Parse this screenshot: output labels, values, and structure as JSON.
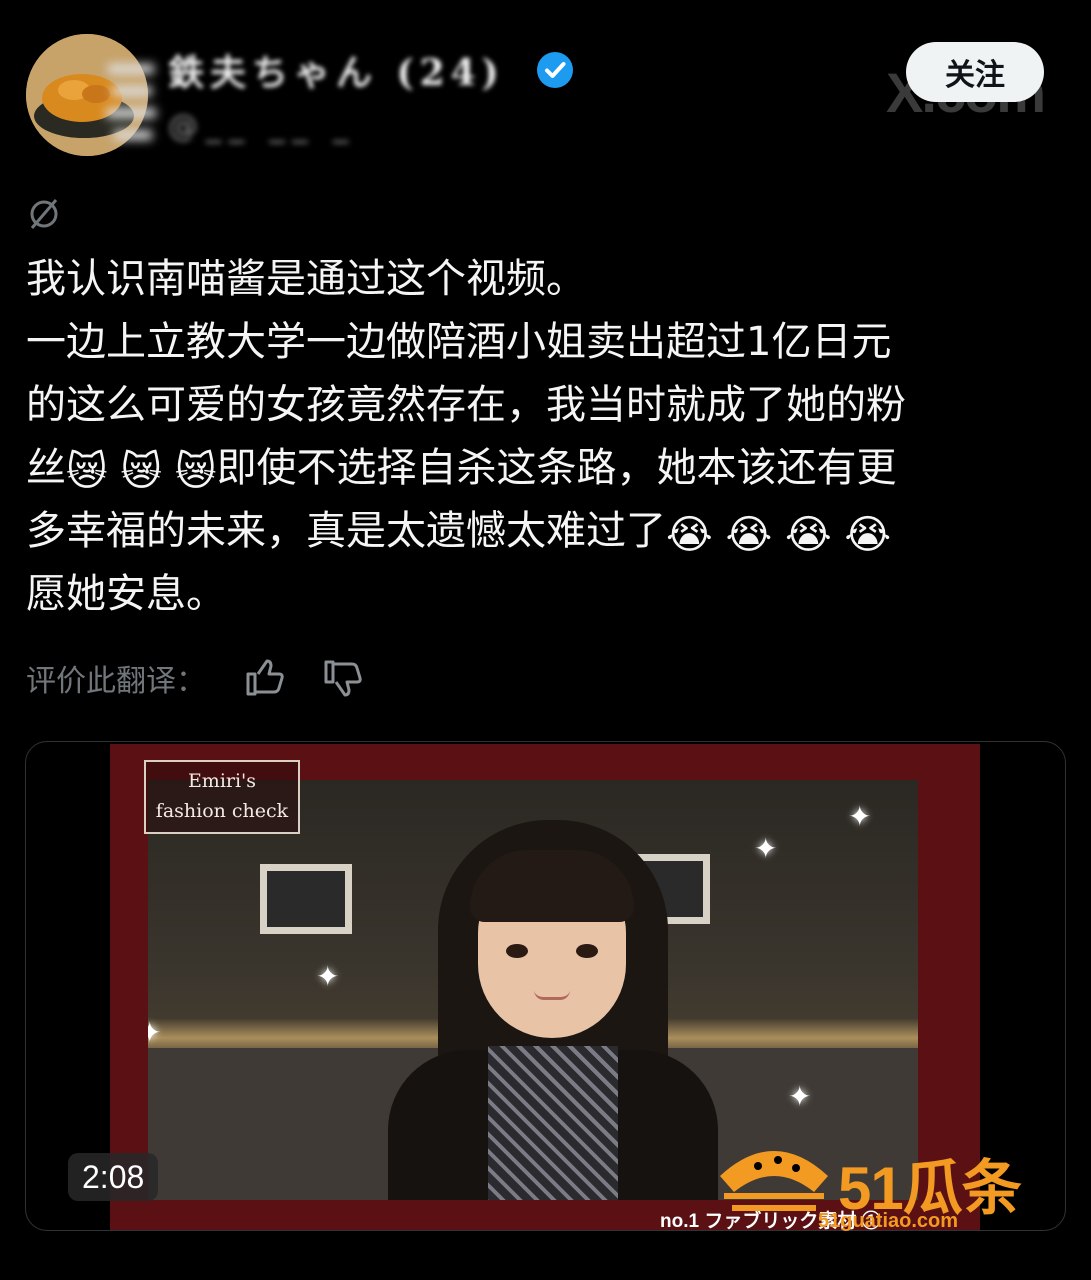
{
  "header": {
    "display_name": "鉄夫ちゃん (24)",
    "handle": "@__ __ _",
    "follow_label": "关注",
    "x_watermark": "X.com"
  },
  "post": {
    "lines": [
      "我认识南喵酱是通过这个视频。",
      "一边上立教大学一边做陪酒小姐卖出超过1亿日元",
      "的这么可爱的女孩竟然存在，我当时就成了她的粉"
    ],
    "line4_prefix": "丝",
    "line4_emoji": [
      "😿",
      "😿",
      "😿"
    ],
    "line4_suffix": "即使不选择自杀这条路，她本该还有更",
    "line5_prefix": "多幸福的未来，真是太遗憾太难过了",
    "line5_emoji": [
      "😭",
      "😭",
      "😭",
      "😭"
    ],
    "line6": "愿她安息。"
  },
  "translation": {
    "rate_label": "评价此翻译："
  },
  "video": {
    "badge_line1": "Emiri's",
    "badge_line2": "fashion check",
    "caption": "no.1 ファブリック素材 ①",
    "duration": "2:08"
  },
  "watermark": {
    "brand": "51瓜条",
    "url": "51guatiao.com"
  },
  "colors": {
    "background": "#000000",
    "verified": "#1d9bf0",
    "follow_bg": "#eff3f4",
    "muted": "#71767b",
    "frame_red": "#5b1014",
    "watermark_orange": "#f39a22"
  }
}
